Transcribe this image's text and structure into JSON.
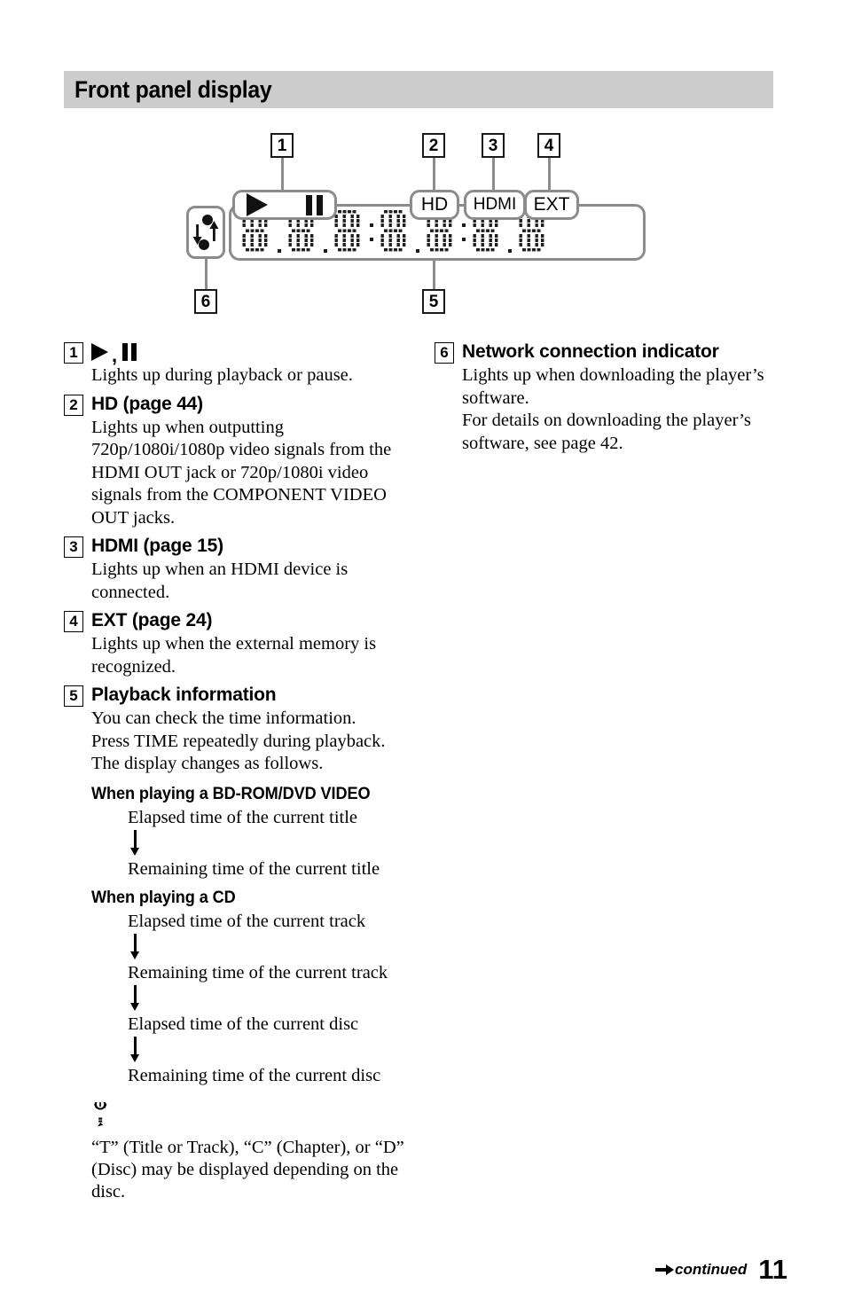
{
  "section": {
    "title": "Front panel display"
  },
  "diagram": {
    "callouts": [
      "1",
      "2",
      "3",
      "4",
      "5",
      "6"
    ],
    "indicators": {
      "play_pause": "play-pause",
      "hd": "HD",
      "hdmi": "HDMI",
      "ext": "EXT"
    },
    "lcd": {
      "character_count": 7,
      "description": "dot-matrix segment display"
    },
    "network_icon": "network-up-down-icon"
  },
  "entries": [
    {
      "num": "1",
      "title_is_glyph": true,
      "title": "▶, ❚❚",
      "body": "Lights up during playback or pause."
    },
    {
      "num": "2",
      "title": "HD (page 44)",
      "body": "Lights up when outputting 720p/1080i/1080p video signals from the HDMI OUT jack or 720p/1080i video signals from the COMPONENT VIDEO OUT jacks."
    },
    {
      "num": "3",
      "title": "HDMI (page 15)",
      "body": "Lights up when an HDMI device is connected."
    },
    {
      "num": "4",
      "title": "EXT (page 24)",
      "body": "Lights up when the external memory is recognized."
    },
    {
      "num": "5",
      "title": "Playback information",
      "body": "You can check the time information.\nPress TIME repeatedly during playback.\nThe display changes as follows."
    }
  ],
  "playback_flows": [
    {
      "subhead": "When playing a BD-ROM/DVD VIDEO",
      "steps": [
        "Elapsed time of the current title",
        "Remaining time of the current title"
      ]
    },
    {
      "subhead": "When playing a CD",
      "steps": [
        "Elapsed time of the current track",
        "Remaining time of the current track",
        "Elapsed time of the current disc",
        "Remaining time of the current disc"
      ]
    }
  ],
  "tip": {
    "icon": "lightbulb-tip-icon",
    "body": "“T” (Title or Track), “C” (Chapter), or “D” (Disc) may be displayed depending on the disc."
  },
  "right_entry": {
    "num": "6",
    "title": "Network connection indicator",
    "body_line1": "Lights up when downloading the player’s software.",
    "body_line2": "For details on downloading the player’s software, see page 42."
  },
  "footer": {
    "continued": "continued",
    "page_number": "11"
  },
  "colors": {
    "header_bg": "#cccccc",
    "panel_stroke": "#8c8c8c",
    "ink": "#000000"
  }
}
